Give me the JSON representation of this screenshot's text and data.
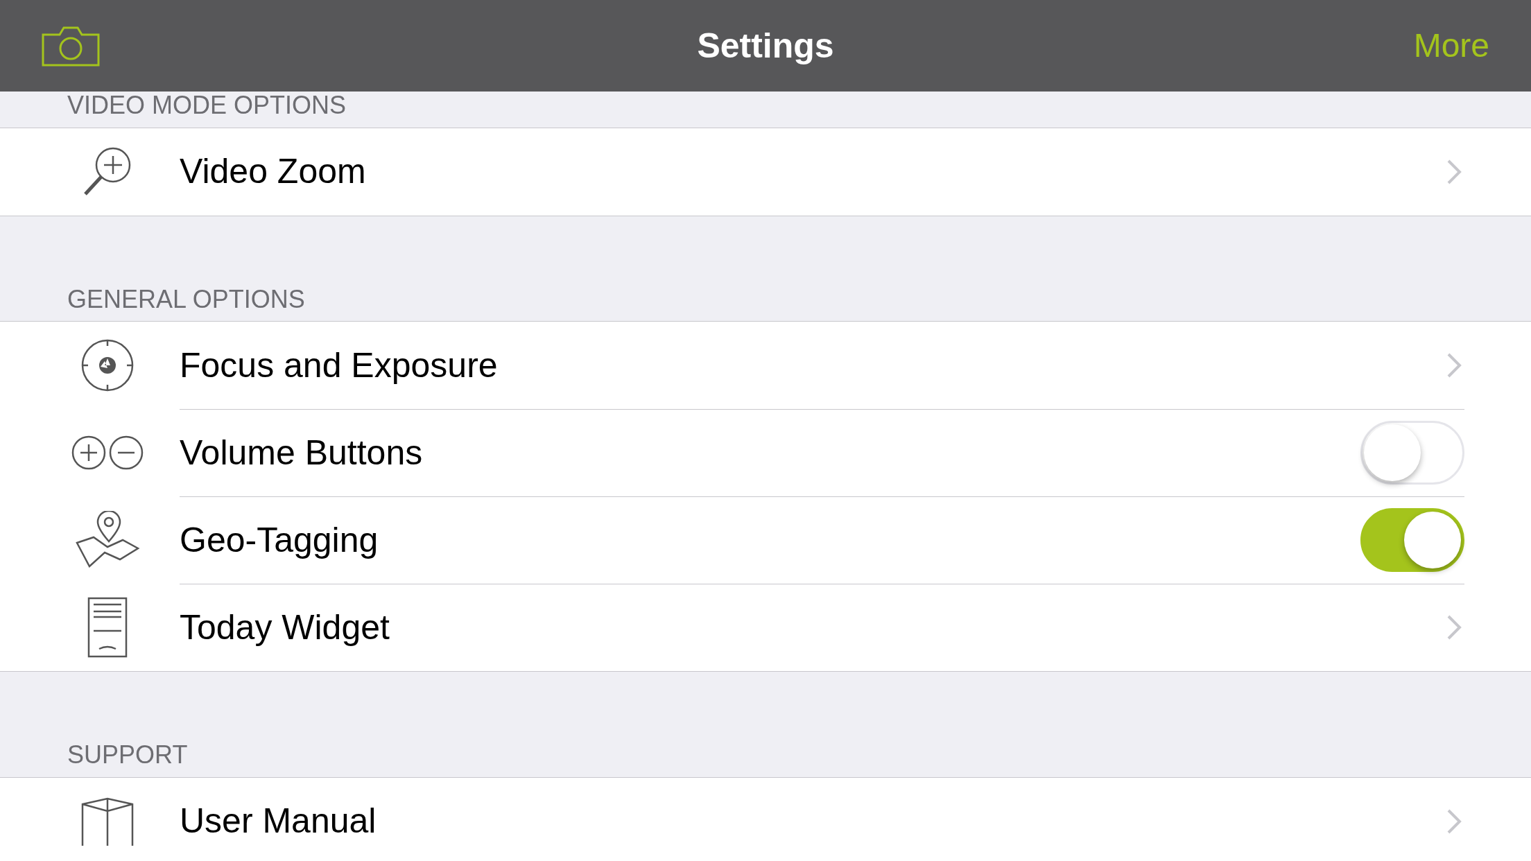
{
  "nav": {
    "title": "Settings",
    "right_button": "More"
  },
  "sections": [
    {
      "header": "VIDEO MODE OPTIONS",
      "rows": [
        {
          "kind": "link",
          "label": "Video Zoom"
        }
      ]
    },
    {
      "header": "GENERAL OPTIONS",
      "rows": [
        {
          "kind": "link",
          "label": "Focus and Exposure"
        },
        {
          "kind": "toggle",
          "label": "Volume Buttons",
          "on": false
        },
        {
          "kind": "toggle",
          "label": "Geo-Tagging",
          "on": true
        },
        {
          "kind": "link",
          "label": "Today Widget"
        }
      ]
    },
    {
      "header": "SUPPORT",
      "rows": [
        {
          "kind": "link",
          "label": "User Manual"
        }
      ]
    }
  ]
}
